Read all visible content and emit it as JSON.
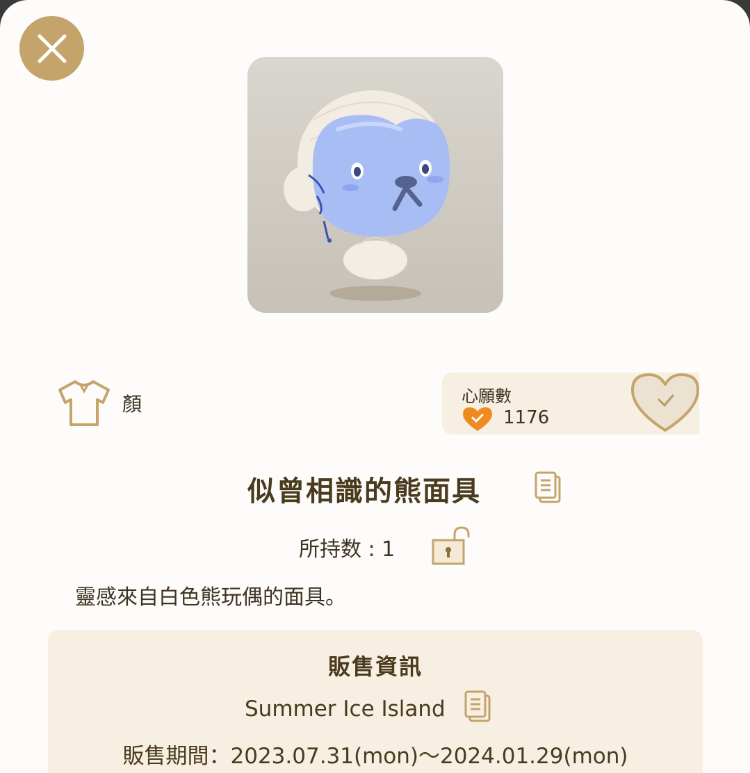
{
  "header": {
    "close_icon": "close-icon"
  },
  "item": {
    "category_icon": "shirt-icon",
    "category_label": "顏",
    "name": "似曾相識的熊面具",
    "owned_text": "所持数 : 1",
    "description": "靈感來自白色熊玩偶的面具。"
  },
  "wishlist": {
    "title": "心願數",
    "count": "1176",
    "heart_button_icon": "heart-check-icon"
  },
  "sale": {
    "title": "販售資訊",
    "event": "Summer Ice Island",
    "period": "販售期間：2023.07.31(mon)～2024.01.29(mon)"
  },
  "colors": {
    "accent_gold": "#c4a46a",
    "panel_bg": "#f6efe2",
    "text_brown": "#4a3a1e",
    "wish_orange": "#ef8a1e"
  }
}
